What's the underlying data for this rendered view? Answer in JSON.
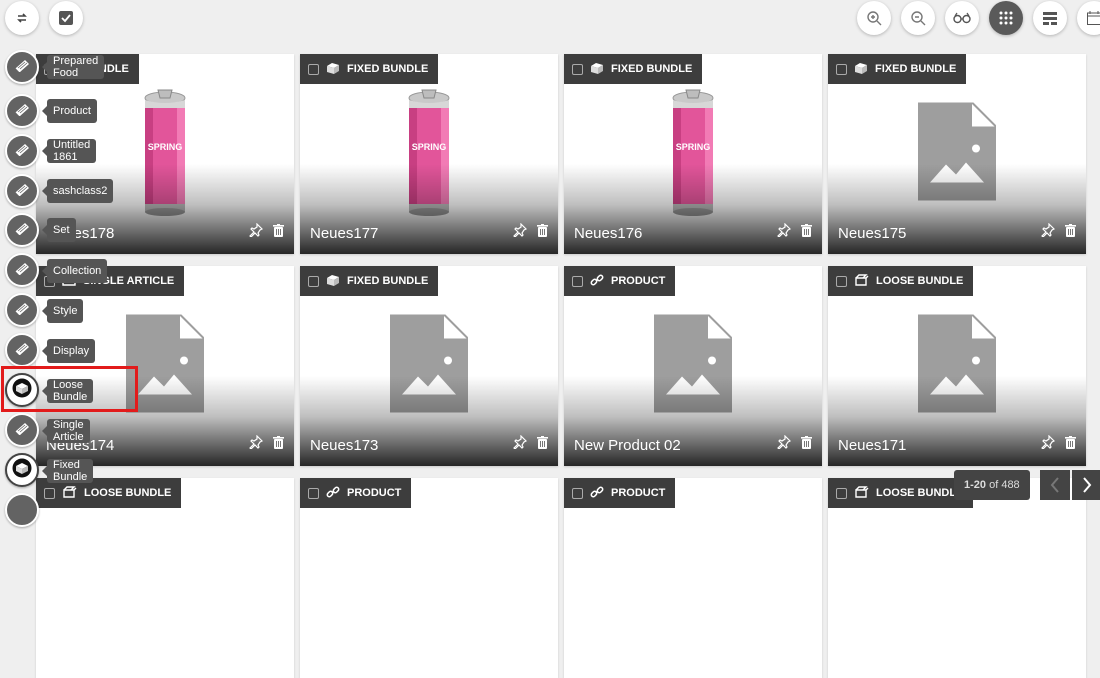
{
  "colors": {
    "accent": "#e21b1b",
    "tag_bg": "#3d3d3d",
    "sidebar_btn": "#636363"
  },
  "topbar": {
    "left": [
      {
        "icon": "refresh-icon"
      },
      {
        "icon": "checkbox-icon"
      }
    ],
    "right": [
      {
        "icon": "zoom-in-icon"
      },
      {
        "icon": "zoom-out-icon"
      },
      {
        "icon": "glasses-icon"
      },
      {
        "icon": "grid-view-icon",
        "active": true
      },
      {
        "icon": "list-view-icon"
      },
      {
        "icon": "calendar-icon"
      }
    ]
  },
  "sidebar": {
    "items": [
      {
        "label": "Prepared Food",
        "icon": "book-icon"
      },
      {
        "label": "Product",
        "icon": "book-icon"
      },
      {
        "label": "Untitled 1861",
        "icon": "book-icon"
      },
      {
        "label": "sashclass2",
        "icon": "book-icon"
      },
      {
        "label": "Set",
        "icon": "book-icon"
      },
      {
        "label": "Collection",
        "icon": "book-icon"
      },
      {
        "label": "Style",
        "icon": "book-icon"
      },
      {
        "label": "Display",
        "icon": "book-icon"
      },
      {
        "label": "Loose Bundle",
        "icon": "box-icon",
        "selected": true
      },
      {
        "label": "Single Article",
        "icon": "book-icon"
      },
      {
        "label": "Fixed Bundle",
        "icon": "box-icon"
      }
    ]
  },
  "cards": [
    {
      "tag": "BUNDLE",
      "name": "Neues178",
      "image": "can",
      "tag_icon": "fixed"
    },
    {
      "tag": "FIXED BUNDLE",
      "name": "Neues177",
      "image": "can",
      "tag_icon": "fixed"
    },
    {
      "tag": "FIXED BUNDLE",
      "name": "Neues176",
      "image": "can",
      "tag_icon": "fixed"
    },
    {
      "tag": "FIXED BUNDLE",
      "name": "Neues175",
      "image": "placeholder",
      "tag_icon": "fixed"
    },
    {
      "tag": "SINGLE ARTICLE",
      "name": "Neues174",
      "image": "placeholder",
      "tag_icon": "single"
    },
    {
      "tag": "FIXED BUNDLE",
      "name": "Neues173",
      "image": "placeholder",
      "tag_icon": "fixed"
    },
    {
      "tag": "PRODUCT",
      "name": "New Product 02",
      "image": "placeholder",
      "tag_icon": "link"
    },
    {
      "tag": "LOOSE BUNDLE",
      "name": "Neues171",
      "image": "placeholder",
      "tag_icon": "loose"
    },
    {
      "tag": "LOOSE BUNDLE",
      "name": "",
      "image": "none",
      "tag_icon": "loose"
    },
    {
      "tag": "PRODUCT",
      "name": "",
      "image": "none",
      "tag_icon": "link"
    },
    {
      "tag": "PRODUCT",
      "name": "",
      "image": "none",
      "tag_icon": "link"
    },
    {
      "tag": "LOOSE BUNDLE",
      "name": "",
      "image": "none",
      "tag_icon": "loose"
    }
  ],
  "pagination": {
    "range": "1-20",
    "of_label": "of 488"
  }
}
